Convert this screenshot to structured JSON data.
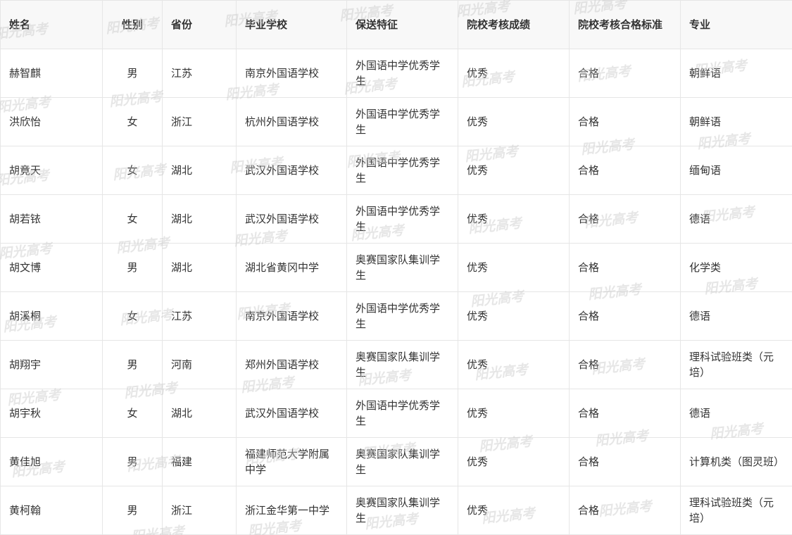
{
  "table": {
    "headers": [
      "姓名",
      "性别",
      "省份",
      "毕业学校",
      "保送特征",
      "院校考核成绩",
      "院校考核合格标准",
      "专业"
    ],
    "rows": [
      [
        "赫智麒",
        "男",
        "江苏",
        "南京外国语学校",
        "外国语中学优秀学生",
        "优秀",
        "合格",
        "朝鲜语"
      ],
      [
        "洪欣怡",
        "女",
        "浙江",
        "杭州外国语学校",
        "外国语中学优秀学生",
        "优秀",
        "合格",
        "朝鲜语"
      ],
      [
        "胡竟天",
        "女",
        "湖北",
        "武汉外国语学校",
        "外国语中学优秀学生",
        "优秀",
        "合格",
        "缅甸语"
      ],
      [
        "胡若铱",
        "女",
        "湖北",
        "武汉外国语学校",
        "外国语中学优秀学生",
        "优秀",
        "合格",
        "德语"
      ],
      [
        "胡文博",
        "男",
        "湖北",
        "湖北省黄冈中学",
        "奥赛国家队集训学生",
        "优秀",
        "合格",
        "化学类"
      ],
      [
        "胡溪桐",
        "女",
        "江苏",
        "南京外国语学校",
        "外国语中学优秀学生",
        "优秀",
        "合格",
        "德语"
      ],
      [
        "胡翔宇",
        "男",
        "河南",
        "郑州外国语学校",
        "奥赛国家队集训学生",
        "优秀",
        "合格",
        "理科试验班类（元培）"
      ],
      [
        "胡宇秋",
        "女",
        "湖北",
        "武汉外国语学校",
        "外国语中学优秀学生",
        "优秀",
        "合格",
        "德语"
      ],
      [
        "黄佳旭",
        "男",
        "福建",
        "福建师范大学附属中学",
        "奥赛国家队集训学生",
        "优秀",
        "合格",
        "计算机类（图灵班）"
      ],
      [
        "黄柯翰",
        "男",
        "浙江",
        "浙江金华第一中学",
        "奥赛国家队集训学生",
        "优秀",
        "合格",
        "理科试验班类（元培）"
      ]
    ]
  },
  "watermark": {
    "text": "阳光高考"
  },
  "colors": {
    "header_bg": "#f8f8f8",
    "border": "#e6e6e6",
    "text": "#333333"
  }
}
